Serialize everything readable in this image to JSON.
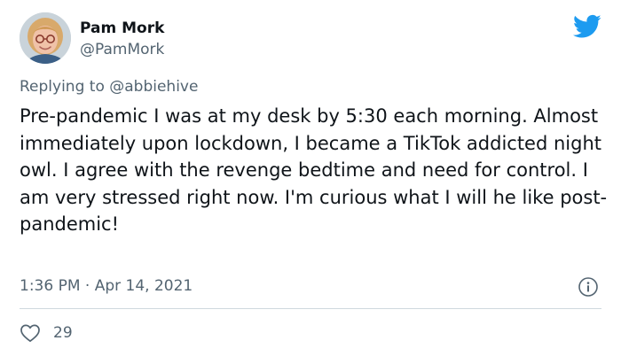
{
  "tweet": {
    "author": {
      "name": "Pam Mork",
      "handle": "@PamMork"
    },
    "reply_prefix": "Replying to ",
    "reply_to": "@abbiehive",
    "text": "Pre-pandemic I was at my desk by 5:30 each morning. Almost immediately upon lockdown, I became a TikTok addicted night owl. I agree with the revenge bedtime and need for control. I am very stressed right now. I'm curious what I will he like post-pandemic!",
    "time": "1:36 PM",
    "separator": "·",
    "date": "Apr 14, 2021",
    "like_count": "29"
  },
  "colors": {
    "accent": "#1d9bf0",
    "text": "#0f1419",
    "secondary": "#536471",
    "divider": "#cfd9de"
  },
  "icons": {
    "brand": "twitter-bird-icon",
    "info": "info-circle-icon",
    "like": "heart-outline-icon"
  }
}
